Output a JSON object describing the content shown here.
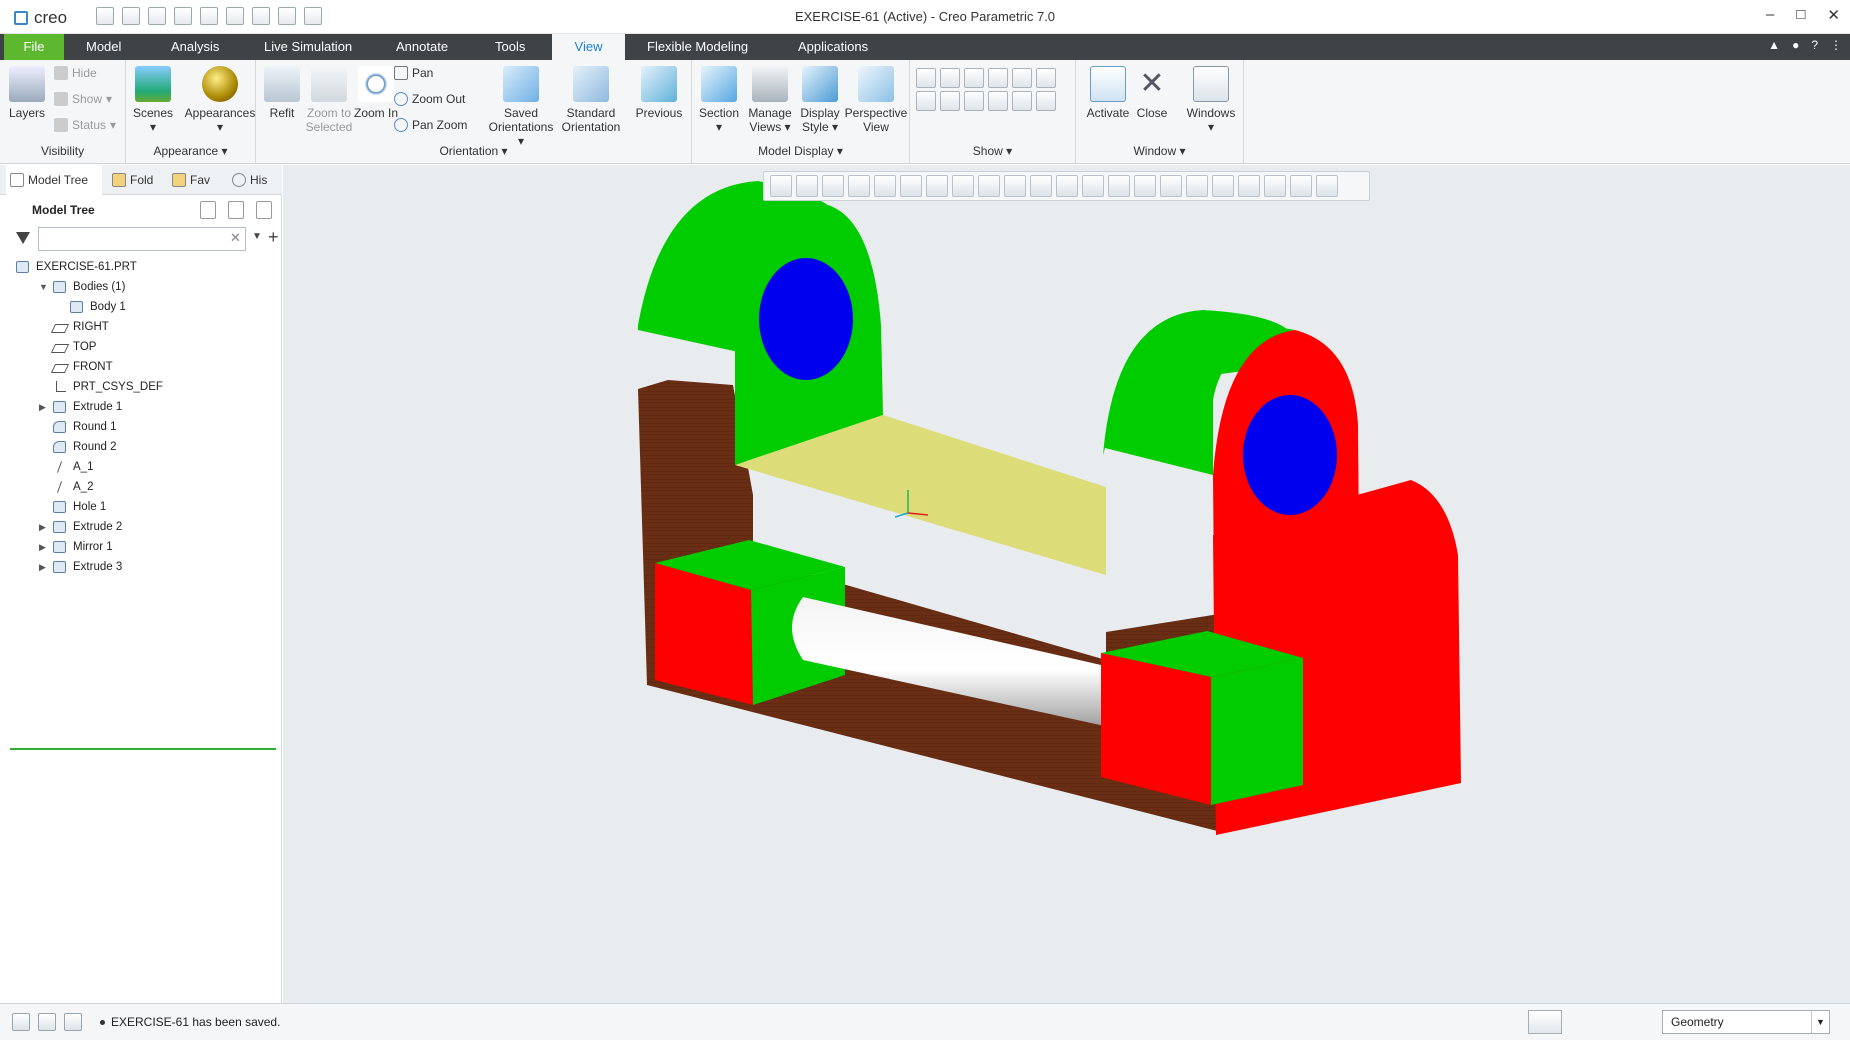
{
  "window": {
    "app_name": "creo",
    "title": "EXERCISE-61 (Active) - Creo Parametric 7.0"
  },
  "tabs": [
    {
      "label": "File"
    },
    {
      "label": "Model"
    },
    {
      "label": "Analysis"
    },
    {
      "label": "Live Simulation"
    },
    {
      "label": "Annotate"
    },
    {
      "label": "Tools"
    },
    {
      "label": "View",
      "active": true
    },
    {
      "label": "Flexible Modeling"
    },
    {
      "label": "Applications"
    }
  ],
  "ribbon": {
    "visibility": {
      "label": "Visibility",
      "layers": "Layers",
      "hide": "Hide",
      "show": "Show",
      "status": "Status"
    },
    "appearance": {
      "label": "Appearance",
      "scenes": "Scenes",
      "appearances": "Appearances"
    },
    "orientation": {
      "label": "Orientation",
      "refit": "Refit",
      "zoom_to_selected": "Zoom to Selected",
      "zoom_in": "Zoom In",
      "pan": "Pan",
      "zoom_out": "Zoom Out",
      "pan_zoom": "Pan Zoom",
      "saved_orientations": "Saved Orientations",
      "standard_orientation": "Standard Orientation",
      "previous": "Previous"
    },
    "model_display": {
      "label": "Model Display",
      "section": "Section",
      "manage_views": "Manage Views",
      "display_style": "Display Style",
      "perspective_view": "Perspective View"
    },
    "show": {
      "label": "Show"
    },
    "window": {
      "label": "Window",
      "activate": "Activate",
      "close": "Close",
      "windows": "Windows"
    }
  },
  "panel": {
    "tabs": [
      {
        "label": "Model Tree"
      },
      {
        "label": "Fold"
      },
      {
        "label": "Fav"
      },
      {
        "label": "His"
      }
    ],
    "header": "Model Tree",
    "search_value": ""
  },
  "tree": [
    {
      "label": "EXERCISE-61.PRT",
      "icon": "part",
      "indent": 0,
      "exp": ""
    },
    {
      "label": "Bodies (1)",
      "icon": "body",
      "indent": 1,
      "exp": "▼"
    },
    {
      "label": "Body 1",
      "icon": "body",
      "indent": 2,
      "exp": ""
    },
    {
      "label": "RIGHT",
      "icon": "plane",
      "indent": 1,
      "exp": ""
    },
    {
      "label": "TOP",
      "icon": "plane",
      "indent": 1,
      "exp": ""
    },
    {
      "label": "FRONT",
      "icon": "plane",
      "indent": 1,
      "exp": ""
    },
    {
      "label": "PRT_CSYS_DEF",
      "icon": "csys",
      "indent": 1,
      "exp": ""
    },
    {
      "label": "Extrude 1",
      "icon": "extrude",
      "indent": 1,
      "exp": "▶"
    },
    {
      "label": "Round 1",
      "icon": "round",
      "indent": 1,
      "exp": ""
    },
    {
      "label": "Round 2",
      "icon": "round",
      "indent": 1,
      "exp": ""
    },
    {
      "label": "A_1",
      "icon": "axis",
      "indent": 1,
      "exp": ""
    },
    {
      "label": "A_2",
      "icon": "axis",
      "indent": 1,
      "exp": ""
    },
    {
      "label": "Hole 1",
      "icon": "hole",
      "indent": 1,
      "exp": ""
    },
    {
      "label": "Extrude 2",
      "icon": "extrude",
      "indent": 1,
      "exp": "▶"
    },
    {
      "label": "Mirror 1",
      "icon": "mirror",
      "indent": 1,
      "exp": "▶"
    },
    {
      "label": "Extrude 3",
      "icon": "extrude",
      "indent": 1,
      "exp": "▶"
    }
  ],
  "status": {
    "message": "EXERCISE-61 has been saved.",
    "filter_value": "Geometry"
  },
  "colors": {
    "tab_bar": "#3f4346",
    "file_tab": "#5eb82f",
    "accent": "#1b7ed6",
    "model_brown": "#6a2e14",
    "model_green": "#00cc00",
    "model_red": "#ff0000",
    "model_blue": "#0000ee",
    "model_yellow": "#dcdc78"
  }
}
